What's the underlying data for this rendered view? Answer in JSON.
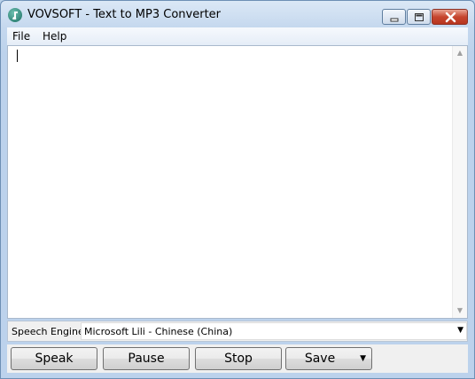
{
  "window": {
    "title": "VOVSOFT - Text to MP3 Converter"
  },
  "window_controls": {
    "minimize_icon": "minimize-icon",
    "maximize_icon": "maximize-icon",
    "close_icon": "close-icon"
  },
  "menu": {
    "items": [
      {
        "label": "File"
      },
      {
        "label": "Help"
      }
    ]
  },
  "editor": {
    "text": ""
  },
  "speech_engine": {
    "label": "Speech Engine:",
    "value": "Microsoft Lili - Chinese (China)"
  },
  "buttons": {
    "speak": "Speak",
    "pause": "Pause",
    "stop": "Stop",
    "save": "Save"
  },
  "colors": {
    "titlebar": "#c5d8ee",
    "close_button": "#c6462f",
    "button_face": "#e5e5e5"
  }
}
